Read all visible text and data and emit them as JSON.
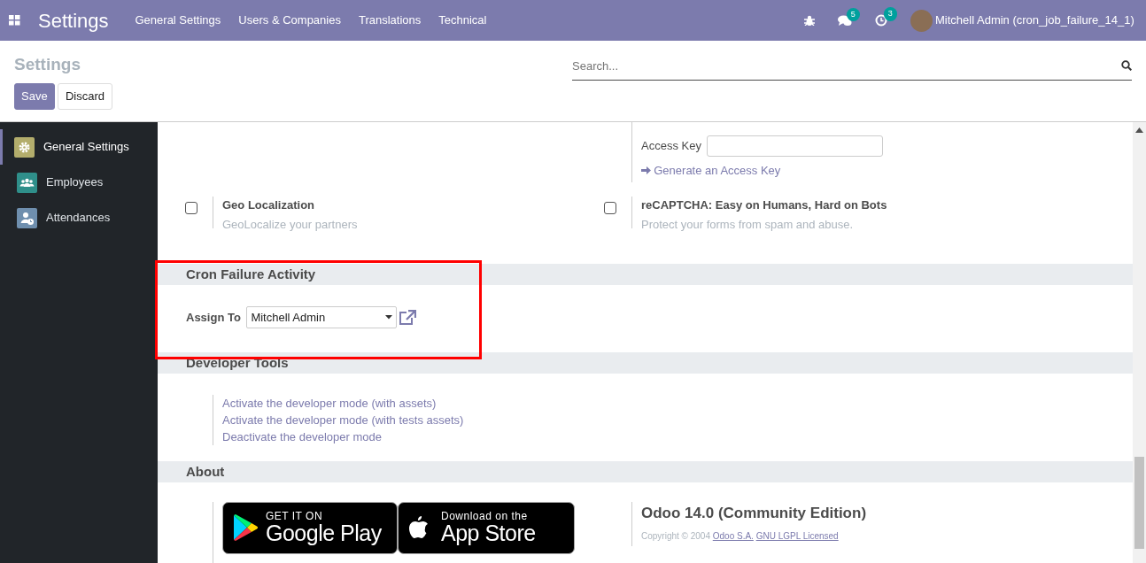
{
  "navbar": {
    "app_name": "Settings",
    "menu": [
      "General Settings",
      "Users & Companies",
      "Translations",
      "Technical"
    ],
    "messages_count": "5",
    "activities_count": "3",
    "user": "Mitchell Admin (cron_job_failure_14_1)"
  },
  "control_panel": {
    "title": "Settings",
    "buttons": [
      {
        "label": "Save",
        "kind": "primary"
      },
      {
        "label": "Discard",
        "kind": "secondary"
      }
    ],
    "search": {
      "placeholder": "Search..."
    }
  },
  "sidebar": {
    "items": [
      {
        "label": "General Settings",
        "kind": "gear",
        "color": "#b3ad6c",
        "selected": true
      },
      {
        "label": "Employees",
        "kind": "people",
        "color": "#2f8f8a",
        "selected": false
      },
      {
        "label": "Attendances",
        "kind": "person-clock",
        "color": "#6f8fae",
        "selected": false
      }
    ]
  },
  "integrations": {
    "access_key": {
      "label": "Access Key"
    },
    "generate_link": "Generate an Access Key",
    "options": [
      {
        "title": "Geo Localization",
        "description": "GeoLocalize your partners",
        "checked": false
      },
      {
        "title": "reCAPTCHA: Easy on Humans, Hard on Bots",
        "description": "Protect your forms from spam and abuse.",
        "checked": false
      }
    ]
  },
  "cron_failure": {
    "title": "Cron Failure Activity",
    "field_label": "Assign To",
    "field_value": "Mitchell Admin"
  },
  "developer_tools": {
    "title": "Developer Tools",
    "links": [
      "Activate the developer mode (with assets)",
      "Activate the developer mode (with tests assets)",
      "Deactivate the developer mode"
    ]
  },
  "about": {
    "title": "About",
    "stores": [
      {
        "kind": "google",
        "line1": "GET IT ON",
        "line2": "Google Play"
      },
      {
        "kind": "apple",
        "line1": "Download on the",
        "line2": "App Store"
      }
    ],
    "version": "Odoo 14.0 (Community Edition)",
    "copyright": "Copyright © 2004",
    "links": [
      "Odoo S.A.",
      "GNU LGPL Licensed"
    ]
  }
}
